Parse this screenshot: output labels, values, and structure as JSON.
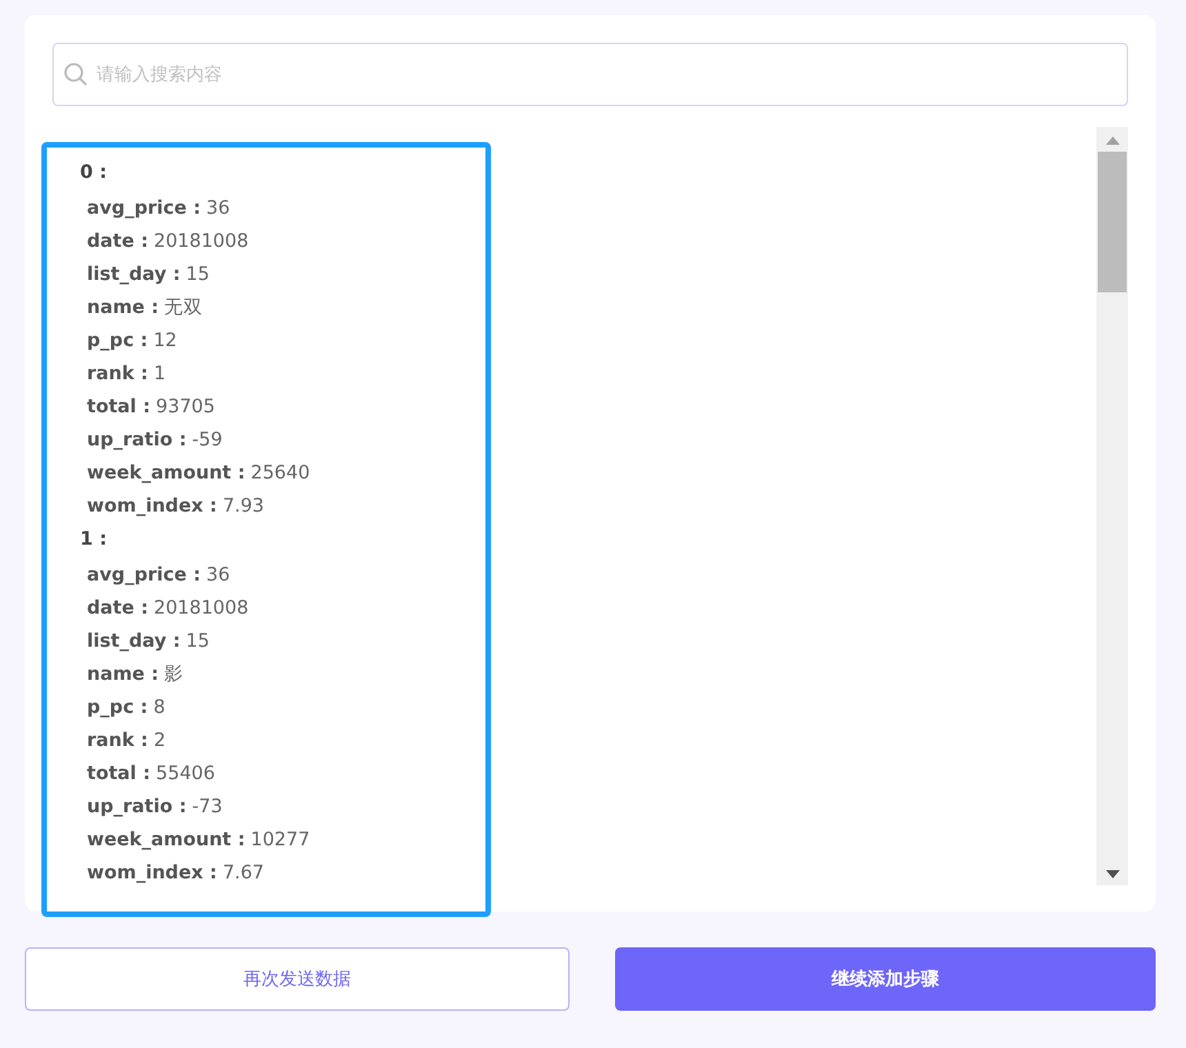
{
  "search": {
    "placeholder": "请输入搜索内容"
  },
  "records": [
    {
      "index": "0 :",
      "fields": [
        {
          "key": "avg_price :",
          "value": "36"
        },
        {
          "key": "date :",
          "value": "20181008"
        },
        {
          "key": "list_day :",
          "value": "15"
        },
        {
          "key": "name :",
          "value": "无双"
        },
        {
          "key": "p_pc :",
          "value": "12"
        },
        {
          "key": "rank :",
          "value": "1"
        },
        {
          "key": "total :",
          "value": "93705"
        },
        {
          "key": "up_ratio :",
          "value": "-59"
        },
        {
          "key": "week_amount :",
          "value": "25640"
        },
        {
          "key": "wom_index :",
          "value": "7.93"
        }
      ]
    },
    {
      "index": "1 :",
      "fields": [
        {
          "key": "avg_price :",
          "value": "36"
        },
        {
          "key": "date :",
          "value": "20181008"
        },
        {
          "key": "list_day :",
          "value": "15"
        },
        {
          "key": "name :",
          "value": "影"
        },
        {
          "key": "p_pc :",
          "value": "8"
        },
        {
          "key": "rank :",
          "value": "2"
        },
        {
          "key": "total :",
          "value": "55406"
        },
        {
          "key": "up_ratio :",
          "value": "-73"
        },
        {
          "key": "week_amount :",
          "value": "10277"
        },
        {
          "key": "wom_index :",
          "value": "7.67"
        }
      ]
    }
  ],
  "buttons": [
    {
      "label": "再次发送数据",
      "kind": "secondary"
    },
    {
      "label": "继续添加步骤",
      "kind": "primary"
    }
  ]
}
